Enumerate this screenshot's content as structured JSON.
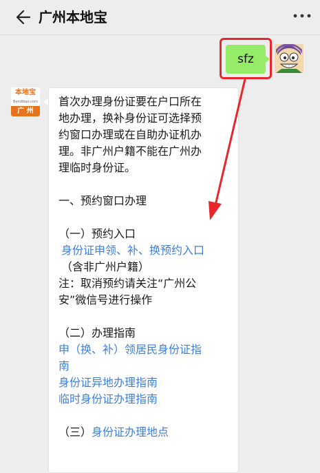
{
  "header": {
    "title": "广州本地宝"
  },
  "user_message": {
    "text": "sfz"
  },
  "bot": {
    "avatar_top": "本地宝",
    "avatar_sub": "Bendibao.com",
    "avatar_bottom": "广 州"
  },
  "reply": {
    "p1": [
      "首次办理身份证要在户口所在",
      "地办理，换补身份证可选择预",
      "约窗口办理或在自助办证机办",
      "理。非广州户籍不能在广州办",
      "理临时身份证。"
    ],
    "sec1_title": "一、预约窗口办理",
    "sub1_title": "（一）预约入口",
    "link1": "身份证申领、补、换预约入口",
    "note1": "（含非广州户籍）",
    "note2": [
      "注：取消预约请关注“广州公",
      "安”微信号进行操作"
    ],
    "sub2_title": "（二）办理指南",
    "links2": [
      "申（换、补）领居民身份证指",
      "南",
      "身份证异地办理指南",
      "临时身份证办理指南"
    ],
    "sub3_prefix": "（三）",
    "sub3_link": "身份证办理地点"
  },
  "colors": {
    "accent_green": "#95ec69",
    "highlight_red": "#e8262b",
    "link_blue": "#3d7ed7"
  }
}
